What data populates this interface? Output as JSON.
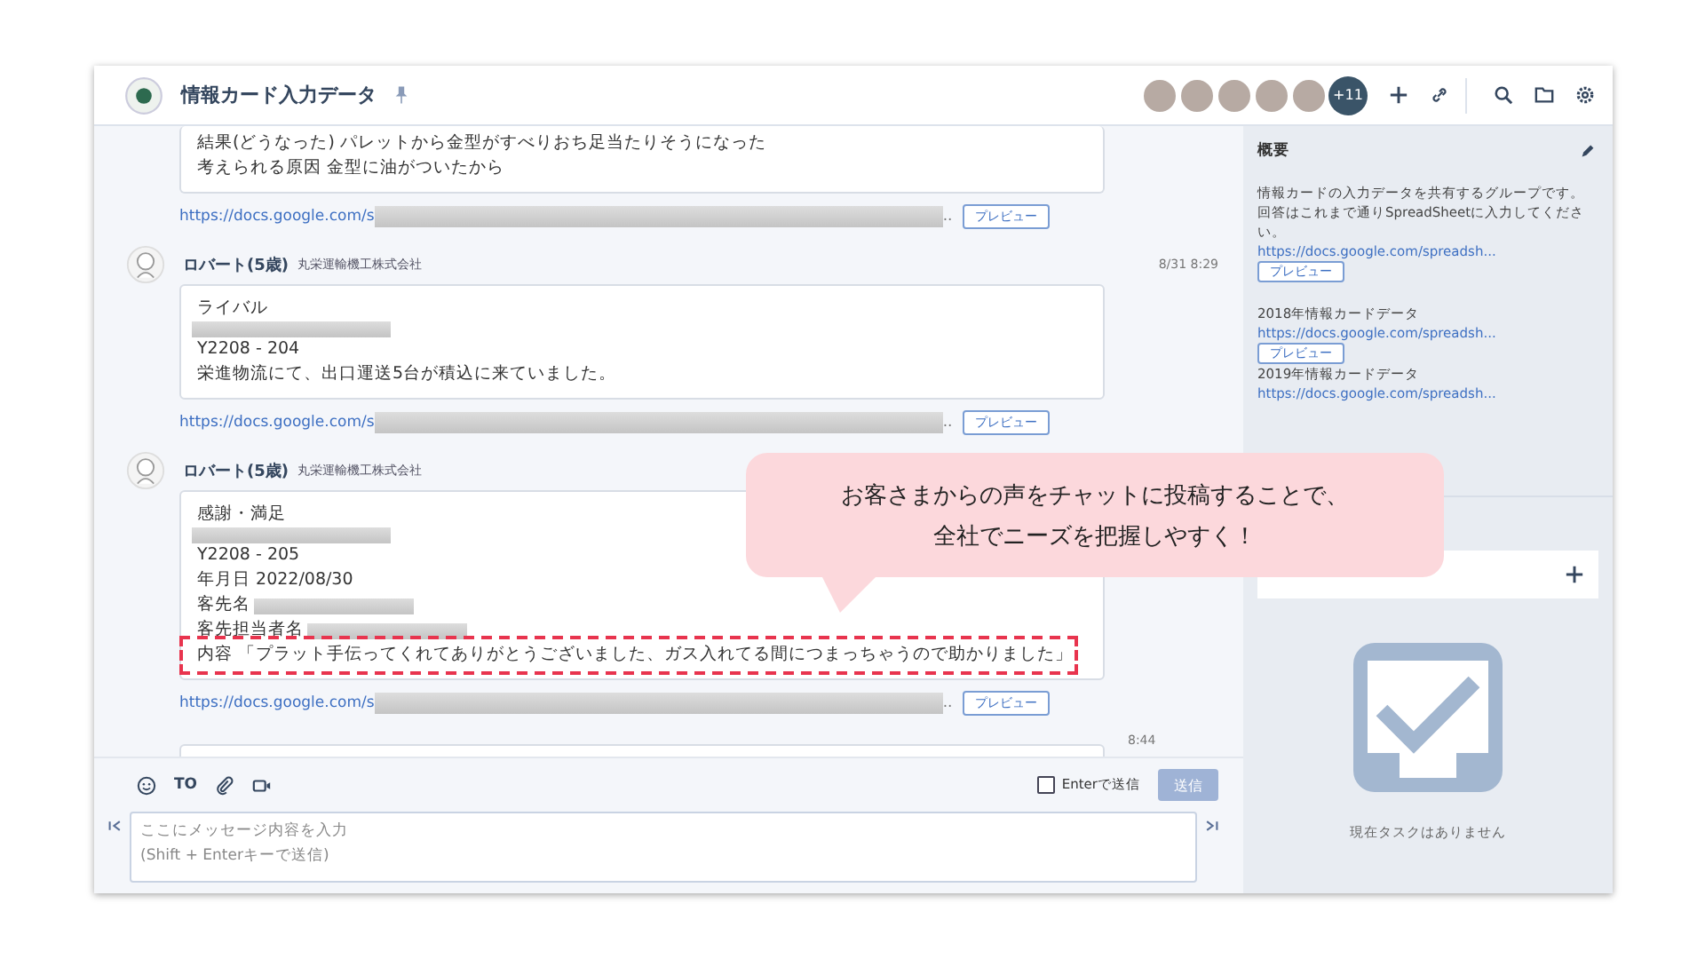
{
  "header": {
    "title": "情報カード入力データ",
    "more_members": "+11"
  },
  "messages": [
    {
      "kind": "continued",
      "lines": [
        {
          "text": "結果(どうなった) パレットから金型がすべりおち足当たりそうになった",
          "redacted": false,
          "highlighted": false
        },
        {
          "text": "考えられる原因 金型に油がついたから",
          "redacted": false,
          "highlighted": false
        }
      ],
      "link": "https://docs.google.com/s",
      "link_end": "..",
      "preview": "プレビュー"
    },
    {
      "kind": "post",
      "author": "ロバート(5歳)",
      "company": "丸栄運輸機工株式会社",
      "time": "8/31 8:29",
      "lines": [
        {
          "text": "ライバル",
          "redacted": false,
          "highlighted": false
        },
        {
          "redacted": true,
          "highlighted": false
        },
        {
          "text": "Y2208 - 204",
          "redacted": false,
          "highlighted": false
        },
        {
          "text": "栄進物流にて、出口運送5台が積込に来ていました。",
          "redacted": false,
          "highlighted": false
        }
      ],
      "link": "https://docs.google.com/s",
      "link_end": "..",
      "preview": "プレビュー"
    },
    {
      "kind": "post",
      "author": "ロバート(5歳)",
      "company": "丸栄運輸機工株式会社",
      "lines": [
        {
          "text": "感謝・満足",
          "redacted": false,
          "highlighted": false
        },
        {
          "redacted": true,
          "highlighted": false
        },
        {
          "text": "Y2208 - 205",
          "redacted": false,
          "highlighted": false
        },
        {
          "text": "年月日 2022/08/30",
          "redacted": false,
          "highlighted": false
        },
        {
          "text": "客先名",
          "redacted": true,
          "highlighted": false
        },
        {
          "text": "客先担当者名",
          "redacted": true,
          "highlighted": false
        },
        {
          "text": "内容 「プラット手伝ってくれてありがとうございました、ガス入れてる間につまっちゃうので助かりました」",
          "redacted": false,
          "highlighted": true
        }
      ],
      "link": "https://docs.google.com/s",
      "link_end": "..",
      "preview": "プレビュー"
    },
    {
      "kind": "cut",
      "time": "8:44"
    }
  ],
  "composer": {
    "to_label": "TO",
    "enter_send": {
      "label": "Enterで送信",
      "checked": false
    },
    "send_button": {
      "label": "送信",
      "disabled": true
    },
    "placeholder": "ここにメッセージ内容を入力\n(Shift + Enterキーで送信)"
  },
  "sidebar": {
    "title": "概要",
    "paragraphs": [
      "情報カードの入力データを共有するグループです。",
      "回答はこれまで通りSpreadSheetに入力してください。"
    ],
    "link": "https://docs.google.com/spreadsh...",
    "preview": "プレビュー",
    "items": [
      {
        "title": "2018年情報カードデータ",
        "link": "https://docs.google.com/spreadsh...",
        "preview": "プレビュー"
      },
      {
        "title": "2019年情報カードデータ",
        "link": "https://docs.google.com/spreadsh..."
      }
    ],
    "tasks": {
      "empty_text": "現在タスクはありません"
    }
  },
  "callout": {
    "lines": [
      "お客さまからの声をチャットに投稿することで、",
      "全社でニーズを把握しやすく！"
    ]
  }
}
